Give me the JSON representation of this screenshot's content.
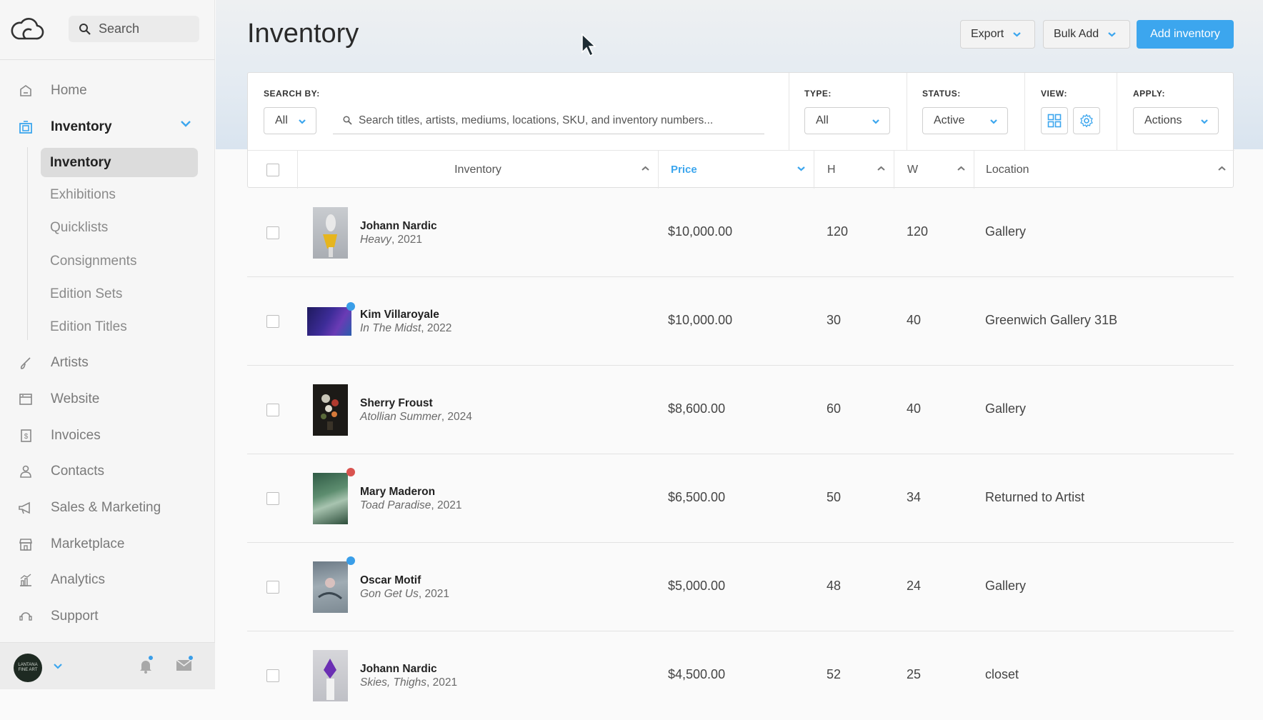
{
  "sidebar": {
    "search_label": "Search",
    "nav": [
      {
        "label": "Home",
        "icon": "home-icon"
      },
      {
        "label": "Inventory",
        "icon": "inventory-icon",
        "active": true
      },
      {
        "label": "Artists",
        "icon": "brush-icon"
      },
      {
        "label": "Website",
        "icon": "browser-icon"
      },
      {
        "label": "Invoices",
        "icon": "invoice-icon"
      },
      {
        "label": "Contacts",
        "icon": "person-icon"
      },
      {
        "label": "Sales & Marketing",
        "icon": "megaphone-icon"
      },
      {
        "label": "Marketplace",
        "icon": "store-icon"
      },
      {
        "label": "Analytics",
        "icon": "chart-icon"
      },
      {
        "label": "Support",
        "icon": "support-icon"
      }
    ],
    "sub": [
      "Inventory",
      "Exhibitions",
      "Quicklists",
      "Consignments",
      "Edition Sets",
      "Edition Titles"
    ],
    "avatar_text": "LANTANA FINE ART"
  },
  "header": {
    "title": "Inventory",
    "export_label": "Export",
    "bulk_label": "Bulk Add",
    "add_label": "Add inventory"
  },
  "filters": {
    "search_by_label": "SEARCH BY:",
    "search_by_value": "All",
    "search_placeholder": "Search titles, artists, mediums, locations, SKU, and inventory numbers...",
    "type_label": "TYPE:",
    "type_value": "All",
    "status_label": "STATUS:",
    "status_value": "Active",
    "view_label": "VIEW:",
    "apply_label": "APPLY:",
    "apply_value": "Actions"
  },
  "table": {
    "headers": {
      "inventory": "Inventory",
      "price": "Price",
      "h": "H",
      "w": "W",
      "location": "Location"
    },
    "rows": [
      {
        "artist": "Johann Nardic",
        "title": "Heavy",
        "year": ", 2021",
        "price": "$10,000.00",
        "h": "120",
        "w": "120",
        "location": "Gallery",
        "dot": null
      },
      {
        "artist": "Kim Villaroyale",
        "title": "In The Midst",
        "year": ", 2022",
        "price": "$10,000.00",
        "h": "30",
        "w": "40",
        "location": "Greenwich Gallery 31B",
        "dot": "#3a9ee8"
      },
      {
        "artist": "Sherry Froust",
        "title": "Atollian Summer",
        "year": ", 2024",
        "price": "$8,600.00",
        "h": "60",
        "w": "40",
        "location": "Gallery",
        "dot": null
      },
      {
        "artist": "Mary Maderon",
        "title": "Toad Paradise",
        "year": ", 2021",
        "price": "$6,500.00",
        "h": "50",
        "w": "34",
        "location": "Returned to Artist",
        "dot": "#d9534f"
      },
      {
        "artist": "Oscar Motif",
        "title": "Gon Get Us",
        "year": ", 2021",
        "price": "$5,000.00",
        "h": "48",
        "w": "24",
        "location": "Gallery",
        "dot": "#3a9ee8"
      },
      {
        "artist": "Johann Nardic",
        "title": "Skies, Thighs",
        "year": ", 2021",
        "price": "$4,500.00",
        "h": "52",
        "w": "25",
        "location": "closet",
        "dot": null
      }
    ]
  },
  "colors": {
    "accent": "#3ca6ee",
    "active_sort": "#3ca6ee"
  }
}
